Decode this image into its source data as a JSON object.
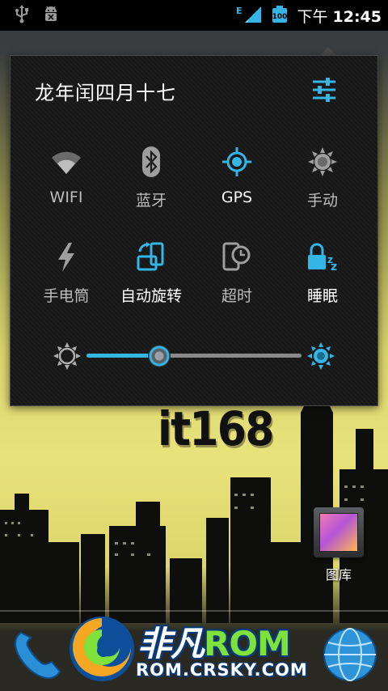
{
  "status_bar": {
    "icons": [
      "usb-icon",
      "debug-android-icon",
      "signal-icon",
      "battery-icon"
    ],
    "network_type": "E",
    "battery_level": "100",
    "time_period": "下午",
    "time": "12:45"
  },
  "quick_settings": {
    "date_label": "龙年闰四月十七",
    "settings_icon": "sliders-icon",
    "tiles": [
      {
        "label": "WIFI",
        "icon": "wifi-icon",
        "active": false
      },
      {
        "label": "蓝牙",
        "icon": "bluetooth-icon",
        "active": false
      },
      {
        "label": "GPS",
        "icon": "gps-icon",
        "active": true
      },
      {
        "label": "手动",
        "icon": "brightness-auto-icon",
        "active": false
      },
      {
        "label": "手电筒",
        "icon": "flashlight-icon",
        "active": false
      },
      {
        "label": "自动旋转",
        "icon": "rotate-icon",
        "active": true
      },
      {
        "label": "超时",
        "icon": "screen-timeout-icon",
        "active": false
      },
      {
        "label": "睡眠",
        "icon": "sleep-lock-icon",
        "active": true
      }
    ],
    "brightness": {
      "level": 0.34
    }
  },
  "wallpaper": {
    "watermark_text": "it168"
  },
  "home": {
    "apps": [
      {
        "label": "图库",
        "icon": "gallery-icon"
      }
    ],
    "dock": {
      "left_icon": "phone-icon",
      "right_icon": "browser-globe-icon"
    }
  },
  "brand": {
    "name_cn": "非凡",
    "name_en": "ROM",
    "url": "ROM.CRSKY.COM"
  },
  "colors": {
    "accent": "#33b5e5",
    "inactive": "#bdbdbd",
    "panel_bg": "#1a1a1a"
  }
}
